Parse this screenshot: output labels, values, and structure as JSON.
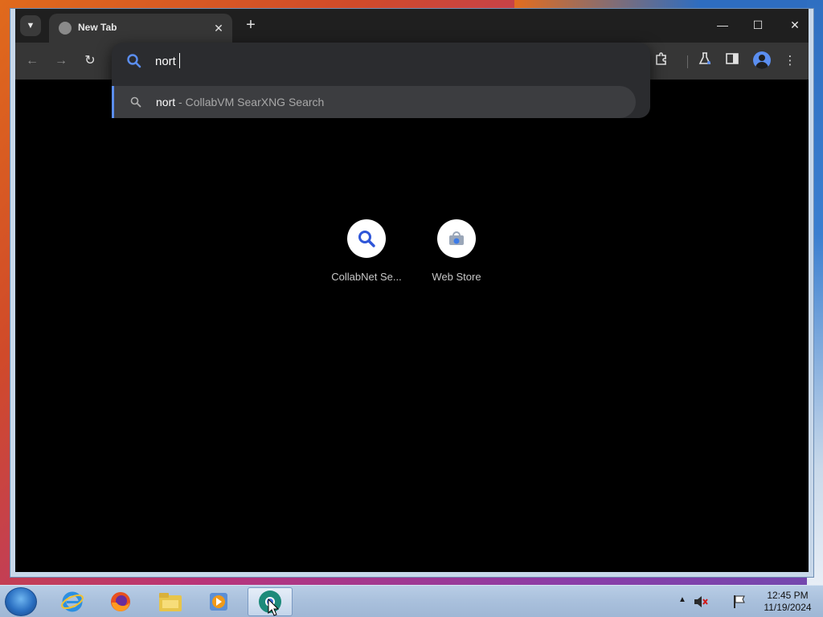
{
  "browser": {
    "tab": {
      "title": "New Tab",
      "favicon": "globe-icon"
    },
    "window_controls": {
      "minimize": "—",
      "maximize": "☐",
      "close": "✕"
    },
    "omnibox": {
      "value": "nort",
      "suggestion": {
        "query": "nort",
        "separator": " - ",
        "description": "CollabVM SearXNG Search"
      }
    },
    "toolbar_icons": [
      "back-icon",
      "forward-icon",
      "reload-icon",
      "extensions-icon",
      "labs-icon",
      "side-panel-icon",
      "profile-icon",
      "menu-icon"
    ]
  },
  "ntp": {
    "shortcuts": [
      {
        "label": "CollabNet Se...",
        "icon": "search-icon"
      },
      {
        "label": "Web Store",
        "icon": "web-store-icon"
      }
    ]
  },
  "taskbar": {
    "apps": [
      "internet-explorer-icon",
      "firefox-icon",
      "file-explorer-icon",
      "media-player-icon",
      "chromium-icon"
    ],
    "clock": {
      "time": "12:45 PM",
      "date": "11/19/2024"
    }
  },
  "colors": {
    "accent": "#5b8ef0",
    "toolbar_bg": "#363636",
    "tabstrip_bg": "#1f1f1f",
    "popup_bg": "#2b2c2f",
    "suggestion_bg": "#3c3d40"
  }
}
